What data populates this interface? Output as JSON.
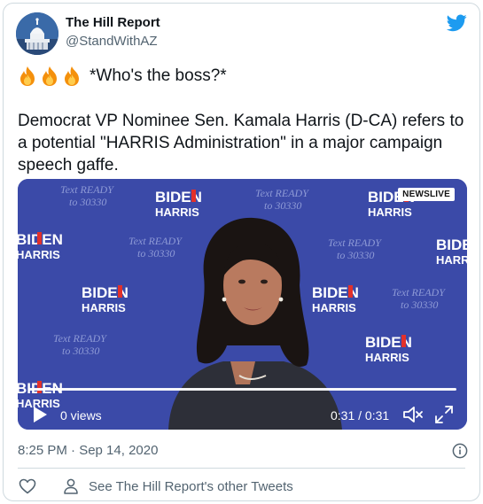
{
  "tweet": {
    "display_name": "The Hill Report",
    "handle": "@StandWithAZ",
    "line1": "*Who's the boss?*",
    "body": "Democrat VP Nominee Sen. Kamala Harris (D-CA) refers to a potential \"HARRIS Administration\" in a major campaign speech gaffe.",
    "timestamp": "8:25 PM · Sep 14, 2020",
    "see_other": "See The Hill Report's other Tweets"
  },
  "video": {
    "views": "0 views",
    "time": "0:31 / 0:31",
    "progress_fraction": 1.0,
    "badge": "NEWSLIVE",
    "backdrop_logo_top": "BIDEN",
    "backdrop_logo_bottom": "HARRIS",
    "backdrop_slogan_1": "Text READY",
    "backdrop_slogan_2": "to 30330"
  },
  "icons": {
    "brand": "twitter-bird-icon",
    "emoji": "fire-emoji",
    "play": "play-icon",
    "volume": "volume-icon",
    "fullscreen": "fullscreen-icon",
    "info": "info-icon",
    "like": "heart-icon",
    "profile": "person-icon"
  },
  "colors": {
    "twitter_blue": "#1d9bf0",
    "secondary_text": "#536471",
    "backdrop_blue": "#3b4aa8",
    "logo_red": "#e2312b"
  }
}
